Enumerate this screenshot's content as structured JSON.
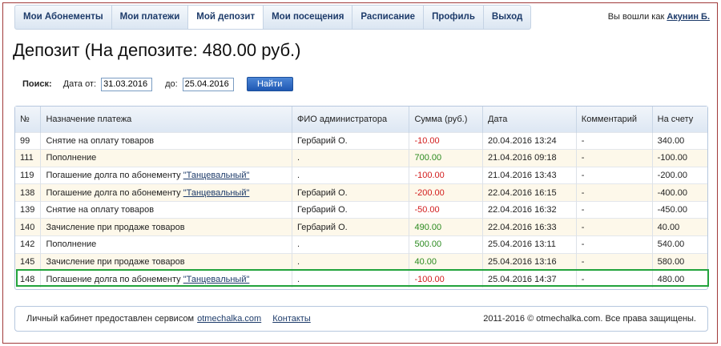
{
  "nav": {
    "items": [
      {
        "label": "Мои Абонементы"
      },
      {
        "label": "Мои платежи"
      },
      {
        "label": "Мой депозит"
      },
      {
        "label": "Мои посещения"
      },
      {
        "label": "Расписание"
      },
      {
        "label": "Профиль"
      },
      {
        "label": "Выход"
      }
    ]
  },
  "user": {
    "prefix": "Вы вошли как",
    "name": "Акунин Б."
  },
  "page_title": "Депозит (На депозите: 480.00 руб.)",
  "search": {
    "label": "Поиск:",
    "date_from_label": "Дата от:",
    "date_from_value": "31.03.2016",
    "date_to_label": "до:",
    "date_to_value": "25.04.2016",
    "button_label": "Найти"
  },
  "table": {
    "headers": [
      "№",
      "Назначение платежа",
      "ФИО администратора",
      "Сумма (руб.)",
      "Дата",
      "Комментарий",
      "На счету"
    ],
    "rows": [
      {
        "num": "99",
        "purpose": "Снятие на оплату товаров",
        "link": "",
        "admin": "Гербарий О.",
        "sum": "-10.00",
        "sign": "neg",
        "date": "20.04.2016 13:24",
        "comment": "-",
        "balance": "340.00"
      },
      {
        "num": "111",
        "purpose": "Пополнение",
        "link": "",
        "admin": ".",
        "sum": "700.00",
        "sign": "pos",
        "date": "21.04.2016 09:18",
        "comment": "-",
        "balance": "-100.00"
      },
      {
        "num": "119",
        "purpose": "Погашение долга по абонементу ",
        "link": "\"Танцевальный\"",
        "admin": ".",
        "sum": "-100.00",
        "sign": "neg",
        "date": "21.04.2016 13:43",
        "comment": "-",
        "balance": "-200.00"
      },
      {
        "num": "138",
        "purpose": "Погашение долга по абонементу ",
        "link": "\"Танцевальный\"",
        "admin": "Гербарий О.",
        "sum": "-200.00",
        "sign": "neg",
        "date": "22.04.2016 16:15",
        "comment": "-",
        "balance": "-400.00"
      },
      {
        "num": "139",
        "purpose": "Снятие на оплату товаров",
        "link": "",
        "admin": "Гербарий О.",
        "sum": "-50.00",
        "sign": "neg",
        "date": "22.04.2016 16:32",
        "comment": "-",
        "balance": "-450.00"
      },
      {
        "num": "140",
        "purpose": "Зачисление при продаже товаров",
        "link": "",
        "admin": "Гербарий О.",
        "sum": "490.00",
        "sign": "pos",
        "date": "22.04.2016 16:33",
        "comment": "-",
        "balance": "40.00"
      },
      {
        "num": "142",
        "purpose": "Пополнение",
        "link": "",
        "admin": ".",
        "sum": "500.00",
        "sign": "pos",
        "date": "25.04.2016 13:11",
        "comment": "-",
        "balance": "540.00"
      },
      {
        "num": "145",
        "purpose": "Зачисление при продаже товаров",
        "link": "",
        "admin": ".",
        "sum": "40.00",
        "sign": "pos",
        "date": "25.04.2016 13:16",
        "comment": "-",
        "balance": "580.00"
      },
      {
        "num": "148",
        "purpose": "Погашение долга по абонементу ",
        "link": "\"Танцевальный\"",
        "admin": ".",
        "sum": "-100.00",
        "sign": "neg",
        "date": "25.04.2016 14:37",
        "comment": "-",
        "balance": "480.00"
      }
    ]
  },
  "footer": {
    "text": "Личный кабинет предоставлен сервисом",
    "service_link": "otmechalka.com",
    "contacts_link": "Контакты",
    "copyright": "2011-2016 © otmechalka.com. Все права защищены."
  },
  "colors": {
    "negative": "#d21d1d",
    "positive": "#2b8a1f",
    "highlight": "#22a33c",
    "frame": "#a13a3a"
  }
}
